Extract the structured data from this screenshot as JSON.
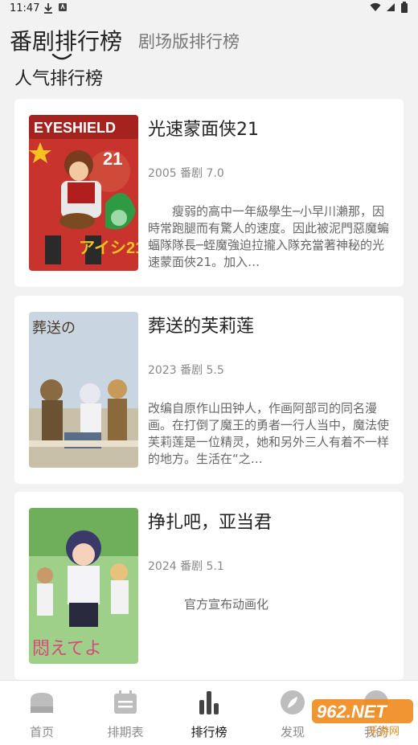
{
  "status_bar": {
    "time": "11:47"
  },
  "header": {
    "active_tab": "番剧排行榜",
    "inactive_tab": "剧场版排行榜"
  },
  "section_title": "人气排行榜",
  "items": [
    {
      "title": "光速蒙面侠21",
      "meta": "2005 番剧 7.0",
      "desc": "　　瘦弱的高中一年級學生─小早川瀨那，因時常跑腿而有驚人的速度。因此被泥門惡魔蝙蝠隊隊長─蛭魔強迫拉攏入隊充當著神秘的光速蒙面俠21。加入…",
      "poster_colors": [
        "#c8332e",
        "#2a8b3a"
      ]
    },
    {
      "title": "葬送的芙莉莲",
      "meta": "2023 番剧 5.5",
      "desc": "改编自原作山田钟人，作画阿部司的同名漫画。在打倒了魔王的勇者一行人当中，魔法使芙莉莲是一位精灵，她和另外三人有着不一样的地方。生活在“之…",
      "poster_colors": [
        "#b7c8d9",
        "#8a7a5c"
      ]
    },
    {
      "title": "挣扎吧，亚当君",
      "meta": "2024 番剧 5.1",
      "desc": "　　　官方宣布动画化",
      "poster_colors": [
        "#6fae5a",
        "#d98fa8"
      ]
    }
  ],
  "bottom_nav": [
    {
      "label": "首页",
      "icon": "home-icon",
      "active": false
    },
    {
      "label": "排期表",
      "icon": "calendar-icon",
      "active": false
    },
    {
      "label": "排行榜",
      "icon": "ranking-icon",
      "active": true
    },
    {
      "label": "发现",
      "icon": "compass-icon",
      "active": false
    },
    {
      "label": "我的",
      "icon": "profile-icon",
      "active": false
    }
  ],
  "watermark": {
    "brand": "962.NET",
    "sub": "乐游网"
  }
}
